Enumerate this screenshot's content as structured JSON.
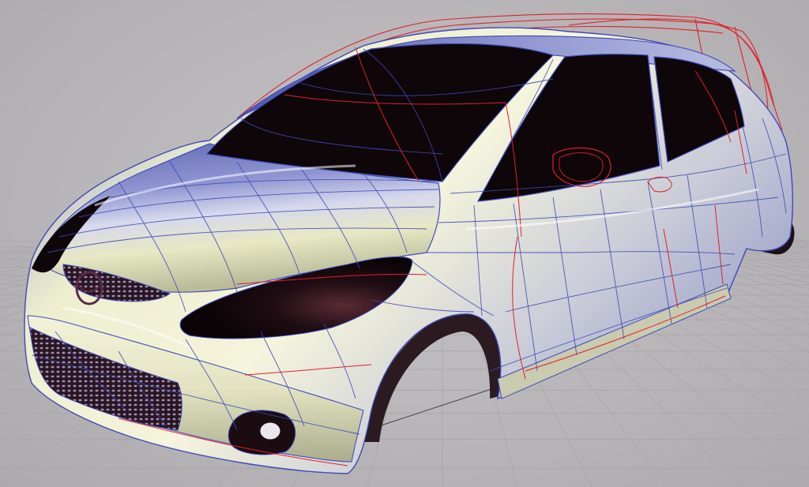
{
  "viewport": {
    "background_color": "#b9b6b9",
    "grid_color": "#a9a6aa"
  },
  "model": {
    "subject": "car-body-surface-model",
    "body_colors": {
      "top_blue": "#5b63b4",
      "mid_lavender": "#b8bde6",
      "lower_cream": "#e8e8c4",
      "highlight": "#ffffff",
      "glass": "#0e0609",
      "headlamp": "#1a0c10",
      "grille": "#2a1622"
    },
    "wire_colors": {
      "isoparm_blue": "#3d49b8",
      "curve_red": "#e0202a",
      "ground_line": "#444444"
    }
  }
}
